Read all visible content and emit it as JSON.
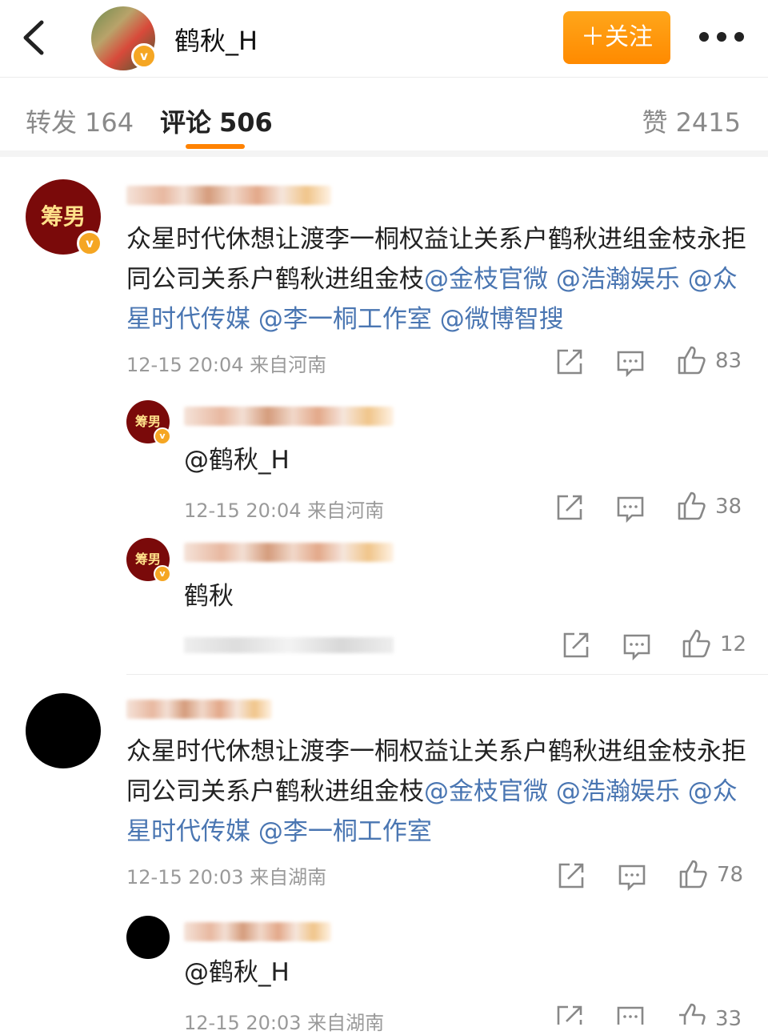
{
  "header": {
    "title": "鹤秋_H",
    "follow_label": "＋关注",
    "verified_mark": "v"
  },
  "tabs": {
    "repost": {
      "label": "转发",
      "count": "164"
    },
    "comment": {
      "label": "评论",
      "count": "506"
    },
    "like": {
      "label": "赞",
      "count": "2415"
    }
  },
  "comments": [
    {
      "avatar_text": "筹男",
      "text": "众星时代休想让渡李一桐权益让关系户鹤秋进组金枝永拒同公司关系户鹤秋进组金枝",
      "mentions": [
        "@金枝官微",
        "@浩瀚娱乐",
        "@众星时代传媒",
        "@李一桐工作室",
        "@微博智搜"
      ],
      "time": "12-15 20:04",
      "location": "来自河南",
      "likes": "83",
      "replies": [
        {
          "avatar_text": "筹男",
          "text": "@鹤秋_H",
          "time": "12-15 20:04",
          "location": "来自河南",
          "likes": "38"
        },
        {
          "avatar_text": "筹男",
          "text": "鹤秋",
          "likes": "12"
        }
      ]
    },
    {
      "text": "众星时代休想让渡李一桐权益让关系户鹤秋进组金枝永拒同公司关系户鹤秋进组金枝",
      "mentions": [
        "@金枝官微",
        "@浩瀚娱乐",
        "@众星时代传媒",
        "@李一桐工作室"
      ],
      "time": "12-15 20:03",
      "location": "来自湖南",
      "likes": "78",
      "replies": [
        {
          "text": "@鹤秋_H",
          "time": "12-15 20:03",
          "location": "来自湖南",
          "likes": "33"
        }
      ]
    }
  ],
  "icons": {
    "back": "back-arrow-icon",
    "more": "more-dots-icon",
    "repost": "repost-icon",
    "comment": "comment-icon",
    "like": "thumbs-up-icon"
  },
  "colors": {
    "accent": "#ff8200",
    "follow_button": "#ff9a0a",
    "mention": "#4a76b2",
    "avatar_maroon": "#7a0a0a",
    "verified": "#f5a623"
  }
}
